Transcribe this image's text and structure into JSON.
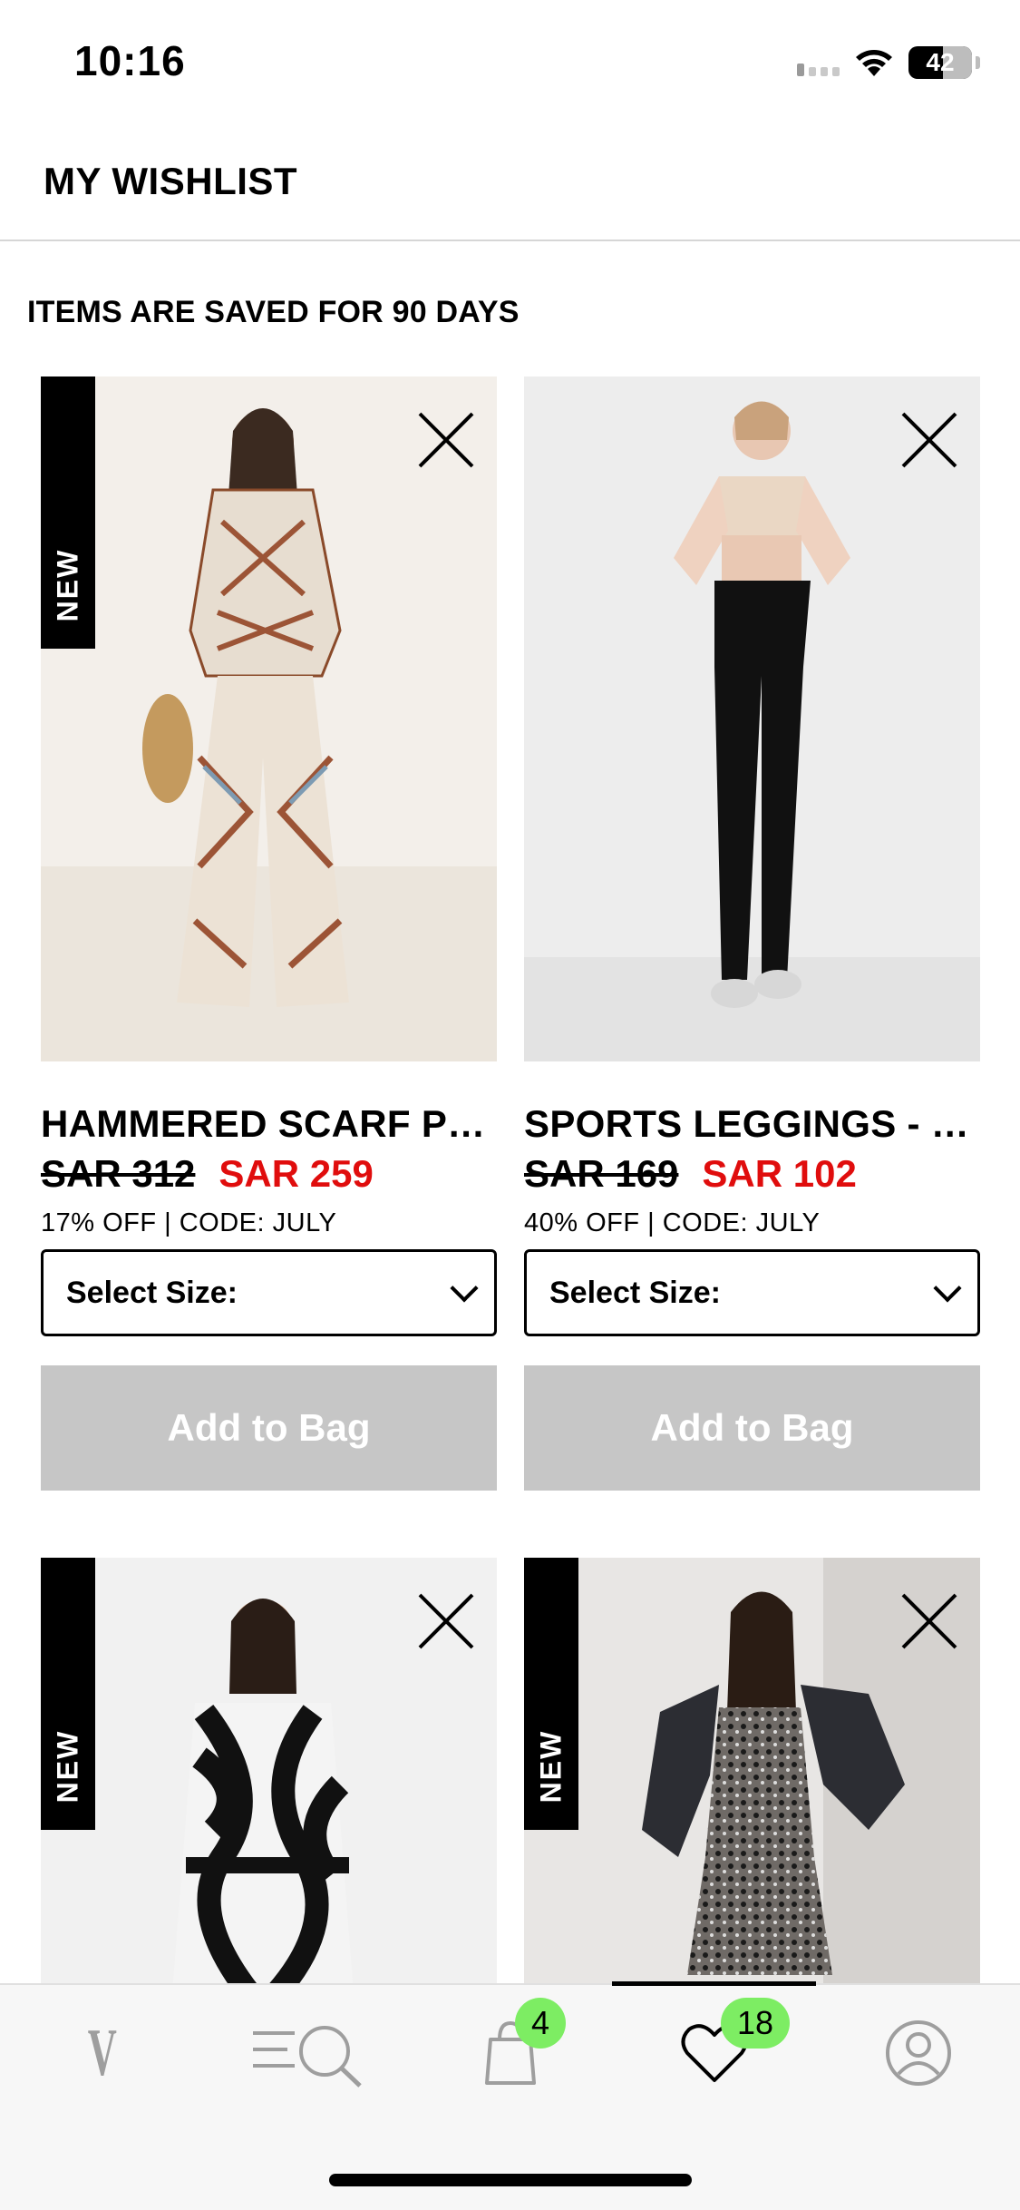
{
  "status_bar": {
    "time": "10:16",
    "battery": "42"
  },
  "header": {
    "title": "MY WISHLIST"
  },
  "saved_note": "ITEMS ARE SAVED FOR 90 DAYS",
  "products": [
    {
      "badge": "NEW",
      "name": "HAMMERED SCARF PRINT SHIRT AND TROUSER SET",
      "old_price": "SAR 312",
      "new_price": "SAR 259",
      "promo": "17% OFF | CODE: JULY",
      "size_label": "Select Size:",
      "add_label": "Add to Bag",
      "image_colors": [
        "#f3efea",
        "#e9e2d8"
      ]
    },
    {
      "badge": "",
      "name": "SPORTS LEGGINGS - BLACK",
      "old_price": "SAR 169",
      "new_price": "SAR 102",
      "promo": "40% OFF | CODE: JULY",
      "size_label": "Select Size:",
      "add_label": "Add to Bag",
      "image_colors": [
        "#ededed",
        "#e6e6e6"
      ]
    },
    {
      "badge": "NEW",
      "image_colors": [
        "#f1f1f1",
        "#e8e8e8"
      ]
    },
    {
      "badge": "NEW",
      "image_colors": [
        "#e8e6e4",
        "#dcd9d6"
      ]
    }
  ],
  "tab_bar": {
    "items": [
      {
        "name": "home",
        "icon": "brand-logo-icon",
        "glyph": "V"
      },
      {
        "name": "search",
        "icon": "search-menu-icon"
      },
      {
        "name": "bag",
        "icon": "bag-icon",
        "badge": "4"
      },
      {
        "name": "wishlist",
        "icon": "heart-icon",
        "badge": "18",
        "active": true
      },
      {
        "name": "account",
        "icon": "user-icon"
      }
    ]
  },
  "colors": {
    "sale_red": "#e00d0d",
    "badge_green": "#7ded63",
    "disabled_button": "#c6c6c6"
  }
}
